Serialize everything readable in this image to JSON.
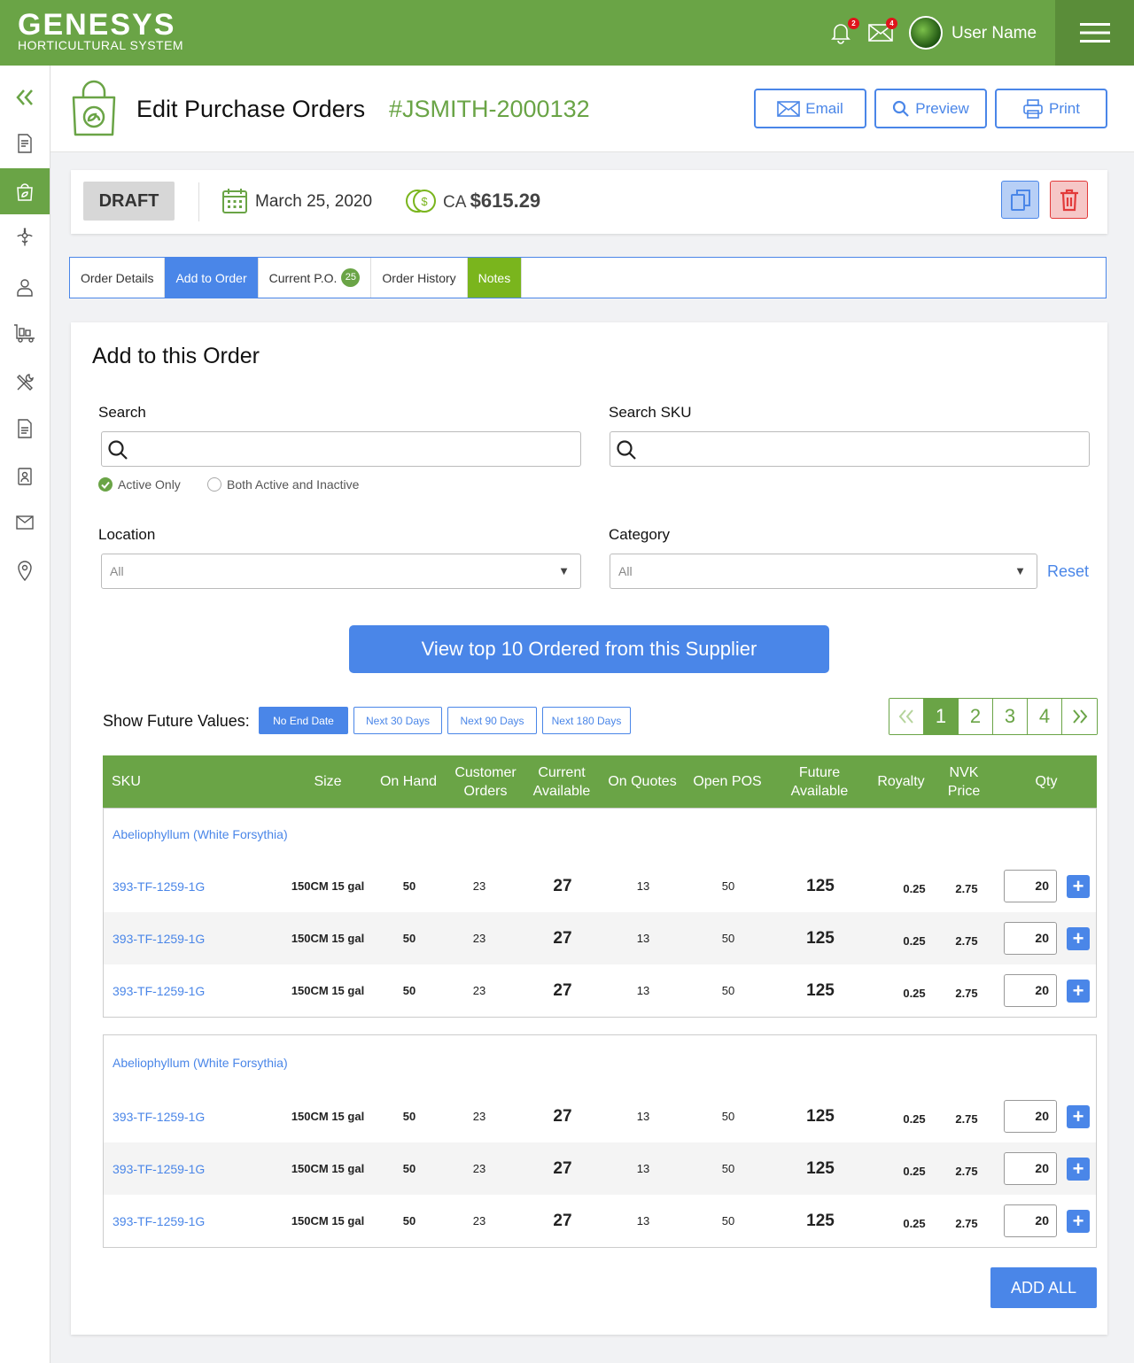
{
  "app": {
    "logo_main": "GENESYS",
    "logo_sub": "HORTICULTURAL SYSTEM",
    "notifications_count": "2",
    "messages_count": "4",
    "user_name": "User Name"
  },
  "header": {
    "title": "Edit Purchase Orders",
    "po_number": "#JSMITH-2000132",
    "email_label": "Email",
    "preview_label": "Preview",
    "print_label": "Print"
  },
  "status": {
    "state": "DRAFT",
    "date": "March 25, 2020",
    "currency": "CA",
    "total": "$615.29"
  },
  "tabs": [
    {
      "label": "Order Details"
    },
    {
      "label": "Add to Order"
    },
    {
      "label": "Current P.O.",
      "badge": "25"
    },
    {
      "label": "Order History"
    },
    {
      "label": "Notes"
    }
  ],
  "panel": {
    "title": "Add to this Order",
    "search_label": "Search",
    "search_value": "",
    "search_sku_label": "Search SKU",
    "search_sku_value": "",
    "radio_active": "Active Only",
    "radio_both": "Both Active and Inactive",
    "location_label": "Location",
    "location_value": "All",
    "category_label": "Category",
    "category_value": "All",
    "reset_label": "Reset",
    "top10_label": "View top 10 Ordered from this Supplier",
    "future_label": "Show Future Values:",
    "future_buttons": [
      "No End Date",
      "Next 30 Days",
      "Next 90 Days",
      "Next 180 Days"
    ],
    "pages": [
      "1",
      "2",
      "3",
      "4"
    ],
    "add_all_label": "ADD ALL"
  },
  "table": {
    "headers": {
      "sku": "SKU",
      "size": "Size",
      "on_hand": "On Hand",
      "customer_orders": "Customer Orders",
      "current_available": "Current Available",
      "on_quotes": "On Quotes",
      "open_pos": "Open POS",
      "future_available": "Future Available",
      "royalty": "Royalty",
      "nvk_price": "NVK Price",
      "qty": "Qty"
    },
    "groups": [
      {
        "name": "Abeliophyllum (White Forsythia)",
        "rows": [
          {
            "sku": "393-TF-1259-1G",
            "size": "150CM 15 gal",
            "on_hand": "50",
            "customer_orders": "23",
            "current_available": "27",
            "on_quotes": "13",
            "open_pos": "50",
            "future_available": "125",
            "royalty": "0.25",
            "nvk_price": "2.75",
            "qty": "20"
          },
          {
            "sku": "393-TF-1259-1G",
            "size": "150CM 15 gal",
            "on_hand": "50",
            "customer_orders": "23",
            "current_available": "27",
            "on_quotes": "13",
            "open_pos": "50",
            "future_available": "125",
            "royalty": "0.25",
            "nvk_price": "2.75",
            "qty": "20"
          },
          {
            "sku": "393-TF-1259-1G",
            "size": "150CM 15 gal",
            "on_hand": "50",
            "customer_orders": "23",
            "current_available": "27",
            "on_quotes": "13",
            "open_pos": "50",
            "future_available": "125",
            "royalty": "0.25",
            "nvk_price": "2.75",
            "qty": "20"
          }
        ]
      },
      {
        "name": "Abeliophyllum (White Forsythia)",
        "rows": [
          {
            "sku": "393-TF-1259-1G",
            "size": "150CM 15 gal",
            "on_hand": "50",
            "customer_orders": "23",
            "current_available": "27",
            "on_quotes": "13",
            "open_pos": "50",
            "future_available": "125",
            "royalty": "0.25",
            "nvk_price": "2.75",
            "qty": "20"
          },
          {
            "sku": "393-TF-1259-1G",
            "size": "150CM 15 gal",
            "on_hand": "50",
            "customer_orders": "23",
            "current_available": "27",
            "on_quotes": "13",
            "open_pos": "50",
            "future_available": "125",
            "royalty": "0.25",
            "nvk_price": "2.75",
            "qty": "20"
          },
          {
            "sku": "393-TF-1259-1G",
            "size": "150CM 15 gal",
            "on_hand": "50",
            "customer_orders": "23",
            "current_available": "27",
            "on_quotes": "13",
            "open_pos": "50",
            "future_available": "125",
            "royalty": "0.25",
            "nvk_price": "2.75",
            "qty": "20"
          }
        ]
      }
    ]
  },
  "colors": {
    "brand_green": "#6aa446",
    "accent_blue": "#4a86e8",
    "danger_red": "#e23a3a"
  }
}
